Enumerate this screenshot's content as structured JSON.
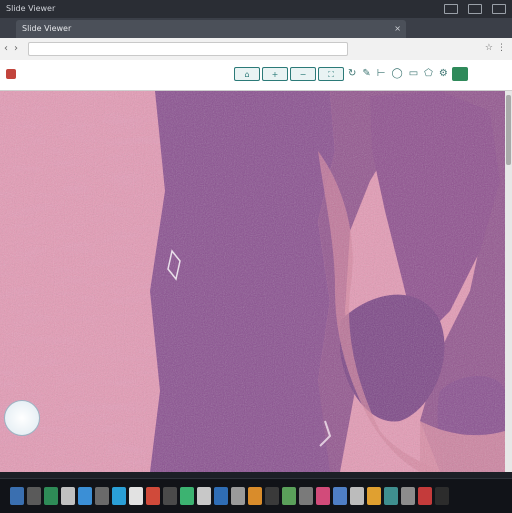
{
  "window": {
    "title": "Slide Viewer",
    "controls": [
      "minimize",
      "maximize",
      "close"
    ]
  },
  "browser": {
    "tab_title": "Slide Viewer",
    "tab_close": "×",
    "url": "",
    "nav_back": "‹",
    "nav_forward": "›",
    "ext_icons": [
      "☆",
      "⋮"
    ]
  },
  "viewer": {
    "title": "",
    "tools": [
      {
        "name": "home-button",
        "label": "⌂"
      },
      {
        "name": "zoom-in-button",
        "label": "+"
      },
      {
        "name": "zoom-out-button",
        "label": "−"
      },
      {
        "name": "fit-button",
        "label": "⛶"
      },
      {
        "name": "rotate-button",
        "label": "↻"
      },
      {
        "name": "annotate-button",
        "label": "✎"
      },
      {
        "name": "ruler-button",
        "label": "⊢"
      },
      {
        "name": "circle-tool",
        "label": "◯"
      },
      {
        "name": "rect-tool",
        "label": "▭"
      },
      {
        "name": "polygon-tool",
        "label": "⬠"
      },
      {
        "name": "settings-button",
        "label": "⚙"
      }
    ],
    "zoom_badge": "",
    "colors": {
      "stroma": "#e59ab5",
      "tumor": "#8a4f90",
      "tumor_dark": "#6e3d7c",
      "accent": "#2b7a78"
    }
  },
  "taskbar": {
    "icons": [
      "#3a6fb0",
      "#5a5a5a",
      "#2e8b57",
      "#c0c0c0",
      "#3b8fd6",
      "#6a6a6a",
      "#2a9fd6",
      "#e2e2e2",
      "#d04a3a",
      "#4a4a4a",
      "#3cb371",
      "#c8c8c8",
      "#2f6db5",
      "#9a9a9a",
      "#d98c2b",
      "#3a3a3a",
      "#5aa05a",
      "#7a7a7a",
      "#d24b7a",
      "#4f7fc6",
      "#bcbcbc",
      "#e0a030",
      "#3f8f8f",
      "#8c8c8c",
      "#c43b3b",
      "#2c2c2c"
    ]
  }
}
